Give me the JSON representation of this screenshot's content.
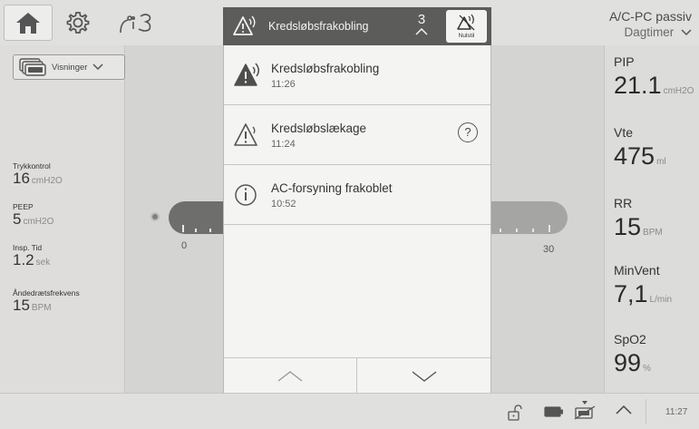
{
  "topbar": {
    "home_icon": "home-icon",
    "settings_icon": "gear-icon",
    "tools_icon": "tools-icon",
    "mode_label": "A/C-PC passiv",
    "time_of_day": "Dagtimer"
  },
  "left": {
    "views_label": "Visninger",
    "settings": [
      {
        "name": "Trykkontrol",
        "value": "16",
        "unit": "cmH2O"
      },
      {
        "name": "PEEP",
        "value": "5",
        "unit": "cmH2O"
      },
      {
        "name": "Insp. Tid",
        "value": "1.2",
        "unit": "sek"
      },
      {
        "name": "Åndedrætsfrekvens",
        "value": "15",
        "unit": "BPM"
      }
    ]
  },
  "gauge": {
    "min_label": "0",
    "max_label": "30"
  },
  "alarms": {
    "header_title": "Kredsløbsfrakobling",
    "count": "3",
    "reset_label": "Nulstil",
    "items": [
      {
        "name": "Kredsløbsfrakobling",
        "time": "11:26",
        "level": "high"
      },
      {
        "name": "Kredsløbslækage",
        "time": "11:24",
        "level": "medium"
      },
      {
        "name": "AC-forsyning frakoblet",
        "time": "10:52",
        "level": "info"
      }
    ]
  },
  "measurements": [
    {
      "name": "PIP",
      "value": "21.1",
      "unit": "cmH2O"
    },
    {
      "name": "Vte",
      "value": "475",
      "unit": "ml"
    },
    {
      "name": "RR",
      "value": "15",
      "unit": "BPM"
    },
    {
      "name": "MinVent",
      "value": "7,1",
      "unit": "L/min"
    },
    {
      "name": "SpO2",
      "value": "99",
      "unit": "%"
    }
  ],
  "status": {
    "clock": "11:27"
  },
  "colors": {
    "alarm_header": "#5c5c5a",
    "popup_bg": "#f4f4f2",
    "screen_bg": "#d7d7d5"
  }
}
